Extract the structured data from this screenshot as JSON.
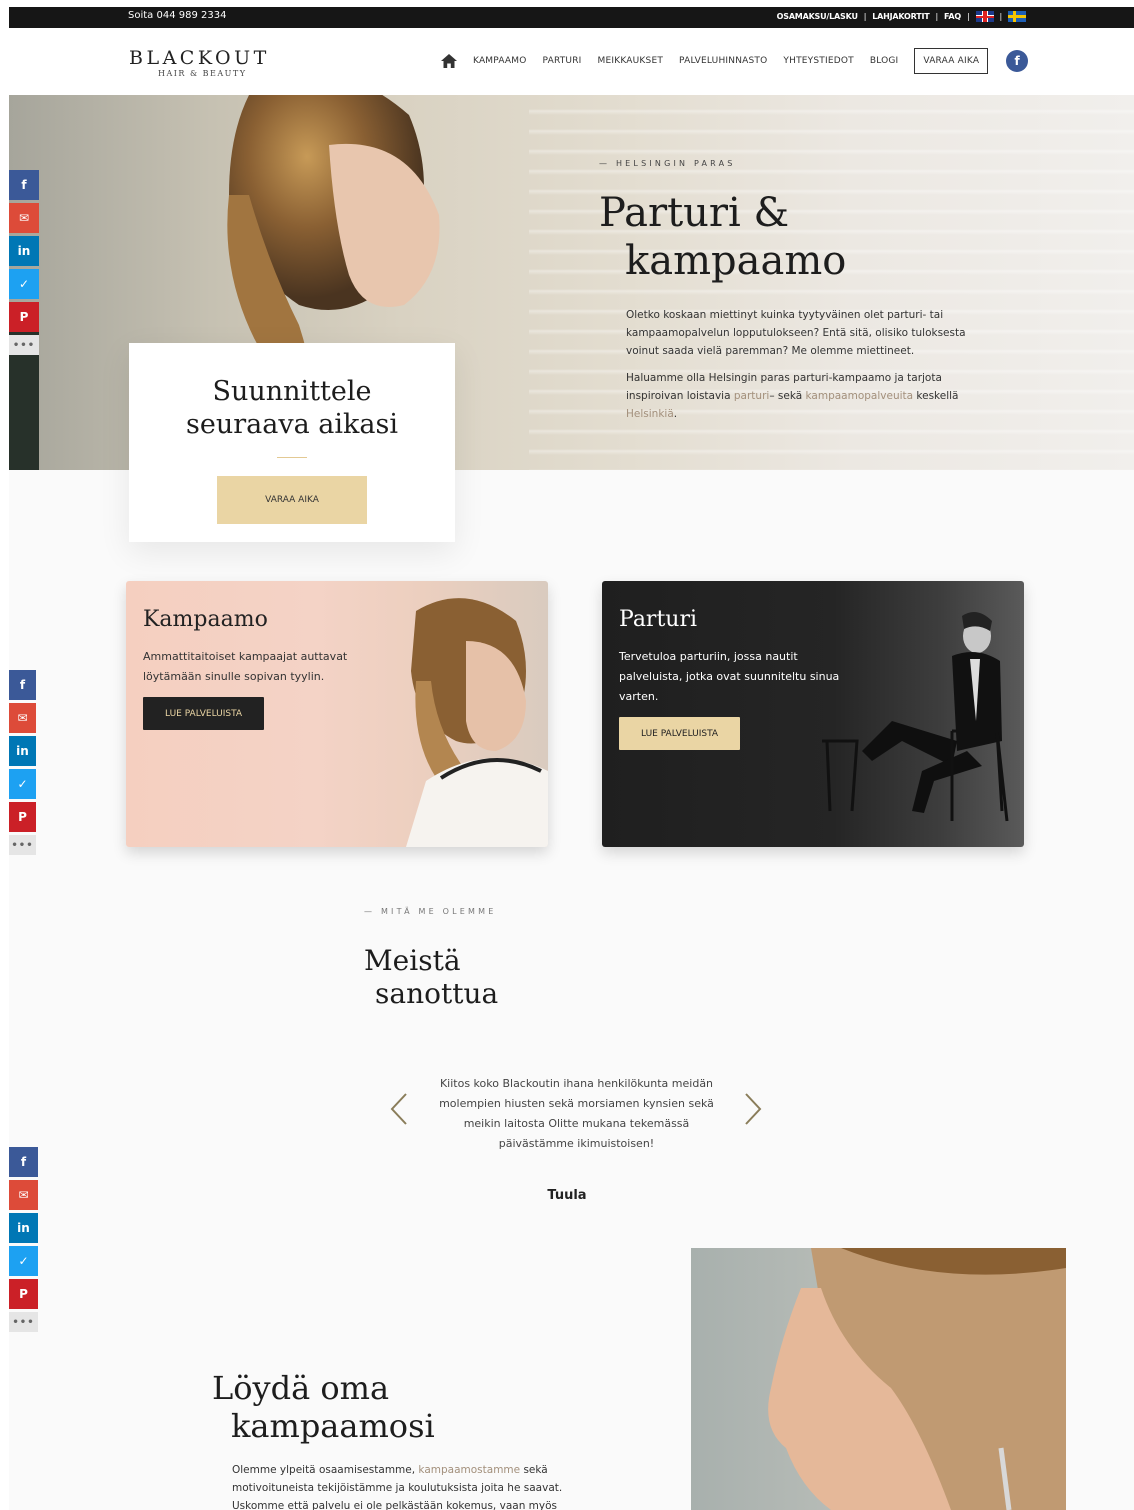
{
  "topbar": {
    "phone": "Soita 044 989 2334",
    "links": [
      "OSAMAKSU/LASKU",
      "LAHJAKORTIT",
      "FAQ"
    ],
    "sep": "|"
  },
  "logo": {
    "main": "BLACKOUT",
    "sub": "HAIR & BEAUTY"
  },
  "nav": {
    "home_icon": "home-icon",
    "items": [
      "KAMPAAMO",
      "PARTURI",
      "MEIKKAUKSET",
      "PALVELUHINNASTO",
      "YHTEYSTIEDOT",
      "BLOGI"
    ],
    "cta": "VARAA AIKA",
    "facebook": "f"
  },
  "hero": {
    "eyebrow": "—   HELSINGIN PARAS",
    "title_l1": "Parturi &",
    "title_l2": "kampaamo",
    "p1": "Oletko koskaan miettinyt kuinka tyytyväinen olet parturi- tai kampaamopalvelun lopputulokseen? Entä sitä, olisiko tuloksesta voinut saada vielä paremman? Me olemme miettineet.",
    "p2_a": "Haluamme olla Helsingin paras parturi-kampaamo ja tarjota inspiroivan loistavia ",
    "p2_link1": "parturi",
    "p2_b": "– sekä ",
    "p2_link2": "kampaamopalveuita",
    "p2_c": " keskellä ",
    "p2_link3": "Helsinkiä",
    "p2_d": "."
  },
  "booking": {
    "title_l1": "Suunnittele",
    "title_l2": "seuraava aikasi",
    "button": "VARAA AIKA"
  },
  "cards": {
    "kampaamo": {
      "title": "Kampaamo",
      "desc": "Ammattitaitoiset kampaajat auttavat löytämään sinulle sopivan tyylin.",
      "button": "LUE PALVELUISTA"
    },
    "parturi": {
      "title": "Parturi",
      "desc": "Tervetuloa parturiin, jossa nautit palveluista, jotka ovat suunniteltu sinua varten.",
      "button": "LUE PALVELUISTA"
    }
  },
  "social": {
    "icons": [
      "facebook-icon",
      "email-icon",
      "linkedin-icon",
      "twitter-icon",
      "pinterest-icon",
      "more-icon"
    ],
    "glyphs": [
      "f",
      "✉",
      "in",
      "✓",
      "P",
      "•••"
    ],
    "colors": [
      "#3b5998",
      "#dd4b39",
      "#0077b5",
      "#1da1f2",
      "#cb2027",
      "#e5e5e5"
    ]
  },
  "testimonials": {
    "eyebrow": "—   MITÄ ME OLEMME",
    "title_l1": "Meistä",
    "title_l2": "sanottua",
    "quote": "Kiitos koko Blackoutin ihana henkilökunta meidän molempien hiusten sekä morsiamen kynsien sekä meikin laitosta  Olitte mukana tekemässä päivästämme ikimuistoisen!",
    "author": "Tuula"
  },
  "find": {
    "title_l1": "Löydä oma",
    "title_l2": "kampaamosi",
    "p_a": "Olemme ylpeitä osaamisestamme, ",
    "p_link": "kampaamostamme",
    "p_b": " sekä motivoituneista tekijöistämme ja koulutuksista joita he saavat. Uskomme että palvelu ei ole pelkästään kokemus, vaan myös"
  },
  "colors": {
    "accent": "#ead5a4",
    "dark": "#161616",
    "link": "#a3907c"
  }
}
